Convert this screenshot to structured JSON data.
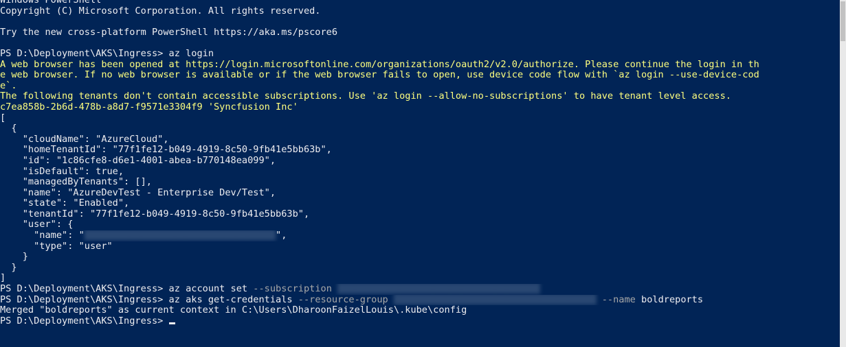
{
  "colors": {
    "background": "#012456",
    "default": "#eeedf0",
    "warning": "#ffff7f",
    "parameter": "#a8a8a8",
    "blurred": "#dfe6f0"
  },
  "console": {
    "lines": [
      [
        {
          "text": "Windows PowerShell",
          "color": "default"
        }
      ],
      [
        {
          "text": "Copyright (C) Microsoft Corporation. All rights reserved.",
          "color": "default"
        }
      ],
      [
        {
          "text": "",
          "color": "default"
        }
      ],
      [
        {
          "text": "Try the new cross-platform PowerShell https://aka.ms/pscore6",
          "color": "default"
        }
      ],
      [
        {
          "text": "",
          "color": "default"
        }
      ],
      [
        {
          "text": "PS D:\\Deployment\\AKS\\Ingress> az login",
          "color": "default"
        }
      ],
      [
        {
          "text": "A web browser has been opened at https://login.microsoftonline.com/organizations/oauth2/v2.0/authorize. Please continue the login in th",
          "color": "warning"
        }
      ],
      [
        {
          "text": "e web browser. If no web browser is available or if the web browser fails to open, use device code flow with `az login --use-device-cod",
          "color": "warning"
        }
      ],
      [
        {
          "text": "e`.",
          "color": "warning"
        }
      ],
      [
        {
          "text": "The following tenants don't contain accessible subscriptions. Use 'az login --allow-no-subscriptions' to have tenant level access.",
          "color": "warning"
        }
      ],
      [
        {
          "text": "c7ea858b-2b6d-478b-a8d7-f9571e3304f9 'Syncfusion Inc'",
          "color": "warning"
        }
      ],
      [
        {
          "text": "[",
          "color": "default"
        }
      ],
      [
        {
          "text": "  {",
          "color": "default"
        }
      ],
      [
        {
          "text": "    \"cloudName\": \"AzureCloud\",",
          "color": "default"
        }
      ],
      [
        {
          "text": "    \"homeTenantId\": \"77f1fe12-b049-4919-8c50-9fb41e5bb63b\",",
          "color": "default"
        }
      ],
      [
        {
          "text": "    \"id\": \"1c86cfe8-d6e1-4001-abea-b770148ea099\",",
          "color": "default"
        }
      ],
      [
        {
          "text": "    \"isDefault\": true,",
          "color": "default"
        }
      ],
      [
        {
          "text": "    \"managedByTenants\": [],",
          "color": "default"
        }
      ],
      [
        {
          "text": "    \"name\": \"AzureDevTest - Enterprise Dev/Test\",",
          "color": "default"
        }
      ],
      [
        {
          "text": "    \"state\": \"Enabled\",",
          "color": "default"
        }
      ],
      [
        {
          "text": "    \"tenantId\": \"77f1fe12-b049-4919-8c50-9fb41e5bb63b\",",
          "color": "default"
        }
      ],
      [
        {
          "text": "    \"user\": {",
          "color": "default"
        }
      ],
      [
        {
          "text": "      \"name\": \"",
          "color": "default"
        },
        {
          "text": "",
          "color": "blurred",
          "blur": 34
        },
        {
          "text": "\",",
          "color": "default"
        }
      ],
      [
        {
          "text": "      \"type\": \"user\"",
          "color": "default"
        }
      ],
      [
        {
          "text": "    }",
          "color": "default"
        }
      ],
      [
        {
          "text": "  }",
          "color": "default"
        }
      ],
      [
        {
          "text": "]",
          "color": "default"
        }
      ],
      [
        {
          "text": "PS D:\\Deployment\\AKS\\Ingress> az account set ",
          "color": "default"
        },
        {
          "text": "--subscription",
          "color": "parameter"
        },
        {
          "text": " ",
          "color": "default"
        },
        {
          "text": "",
          "color": "blurred",
          "blur": 36
        }
      ],
      [
        {
          "text": "PS D:\\Deployment\\AKS\\Ingress> az aks get-credentials ",
          "color": "default"
        },
        {
          "text": "--resource-group",
          "color": "parameter"
        },
        {
          "text": " ",
          "color": "default"
        },
        {
          "text": "",
          "color": "blurred",
          "blur": 36
        },
        {
          "text": " ",
          "color": "default"
        },
        {
          "text": "--name",
          "color": "parameter"
        },
        {
          "text": " boldreports",
          "color": "default"
        }
      ],
      [
        {
          "text": "Merged \"boldreports\" as current context in C:\\Users\\DharoonFaizelLouis\\.kube\\config",
          "color": "default"
        }
      ],
      [
        {
          "text": "PS D:\\Deployment\\AKS\\Ingress> ",
          "color": "default"
        },
        {
          "text": "",
          "color": "default",
          "cursor": true
        }
      ]
    ]
  },
  "scrollbar": {
    "icon": "vertical-scrollbar"
  }
}
